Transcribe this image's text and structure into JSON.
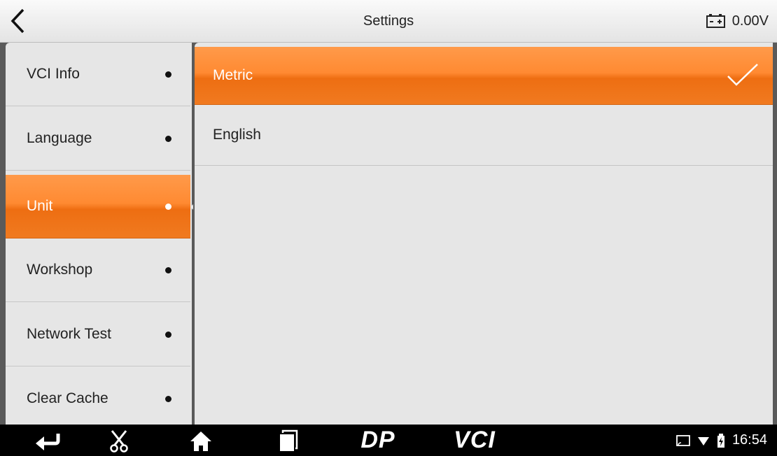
{
  "header": {
    "title": "Settings",
    "voltage": "0.00V"
  },
  "sidebar": {
    "items": [
      {
        "label": "VCI Info",
        "active": false
      },
      {
        "label": "Language",
        "active": false
      },
      {
        "label": "Unit",
        "active": true
      },
      {
        "label": "Workshop",
        "active": false
      },
      {
        "label": "Network Test",
        "active": false
      },
      {
        "label": "Clear Cache",
        "active": false
      }
    ]
  },
  "main": {
    "options": [
      {
        "label": "Metric",
        "selected": true
      },
      {
        "label": "English",
        "selected": false
      }
    ]
  },
  "navbar": {
    "brand_dp": "DP",
    "brand_vci": "VCI",
    "clock": "16:54",
    "icons": [
      "back-arrow-icon",
      "scissors-icon",
      "home-icon",
      "recent-apps-icon",
      "cast-icon",
      "wifi-icon",
      "battery-icon"
    ]
  },
  "colors": {
    "accent": "#f07a20",
    "accent_light": "#ff9a4a",
    "panel_bg": "#e6e6e6",
    "navbar_bg": "#000000"
  }
}
